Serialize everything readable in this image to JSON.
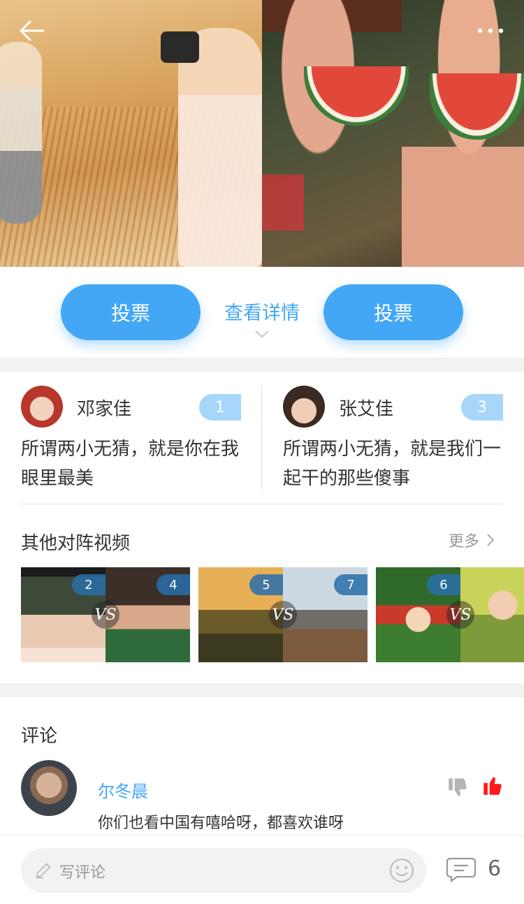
{
  "hero": {
    "back_icon": "back-arrow-icon",
    "more_icon": "more-dots-icon"
  },
  "vote": {
    "left_label": "投票",
    "right_label": "投票",
    "details_label": "查看详情"
  },
  "contestants": [
    {
      "name": "邓家佳",
      "votes": "1",
      "quote": "所谓两小无猜，就是你在我眼里最美"
    },
    {
      "name": "张艾佳",
      "votes": "3",
      "quote": "所谓两小无猜，就是我们一起干的那些傻事"
    }
  ],
  "other_matchups": {
    "title": "其他对阵视频",
    "more_label": "更多",
    "vs_label": "VS",
    "items": [
      {
        "left_badge": "2",
        "right_badge": "4"
      },
      {
        "left_badge": "5",
        "right_badge": "7"
      },
      {
        "left_badge": "6",
        "right_badge": ""
      }
    ]
  },
  "comments": {
    "title": "评论",
    "items": [
      {
        "user": "尔冬晨",
        "text": "你们也看中国有嘻哈呀，都喜欢谁呀"
      }
    ]
  },
  "bottom_bar": {
    "input_placeholder": "写评论",
    "comment_count": "6"
  },
  "colors": {
    "accent": "#43a7f5",
    "badge": "#a8d6fa",
    "like_red": "#ff1a1a",
    "divider_bg": "#f2f2f2"
  }
}
